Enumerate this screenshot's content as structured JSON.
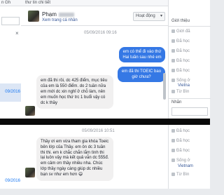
{
  "tabs": {
    "left_label": "n Gh",
    "center_label": "thư tin chi tiết"
  },
  "left": {
    "dates": [
      "09/2016",
      "09/2016"
    ]
  },
  "chat_header": {
    "name": "Phạm",
    "profile_link": "Xem trang cá nhân",
    "activity_button": "Hoạt động"
  },
  "messages": {
    "timestamp_1": "05/09/2016 09:16",
    "out_1": "em có thể đi vào thứ Hai tuần sau nhé em",
    "out_2": "em đã thi TOEIC bao giờ chưa?",
    "in_1": "em đã thi rồi, dc 425 điểm, mục tiêu của em là 550 điểm. do 2 tuần nữa em mới dc xin nghỉ ở chỗ làm, nên em muốn học thứ trc 1 buổi vậy có dc k thầy",
    "timestamp_2": "05/09/2016 10:51",
    "in_2": "Thầy ơi em vừa tham gia khóa Toeic bên lớp của Thầy. em ôn dc 3 tuần thi thi. em k chắc chắn lắm tình thi lại luôn vậy mà kết quả vẫn dc 555đ. em cảm ơn thầy nhiều nha. Chúc lớp thầy ngày càng giúp dc nhiều bạn sv như em hơn 😄"
  },
  "right": {
    "section_info": "Giới thiệu",
    "items_top": [
      "Giới đã",
      "Đã học",
      "Đã học",
      "Đã học",
      "Đã học",
      "Sống ở"
    ],
    "link_top": "Vietna",
    "item_tu": "Từ Bìn",
    "section_labels": "Nhãn",
    "items_bottom": [
      "Đã học",
      "Đã học",
      "Đã học",
      "Sống ở"
    ],
    "link_bottom": "Vietnam",
    "item_tu_bottom": "Từ Bìn"
  }
}
